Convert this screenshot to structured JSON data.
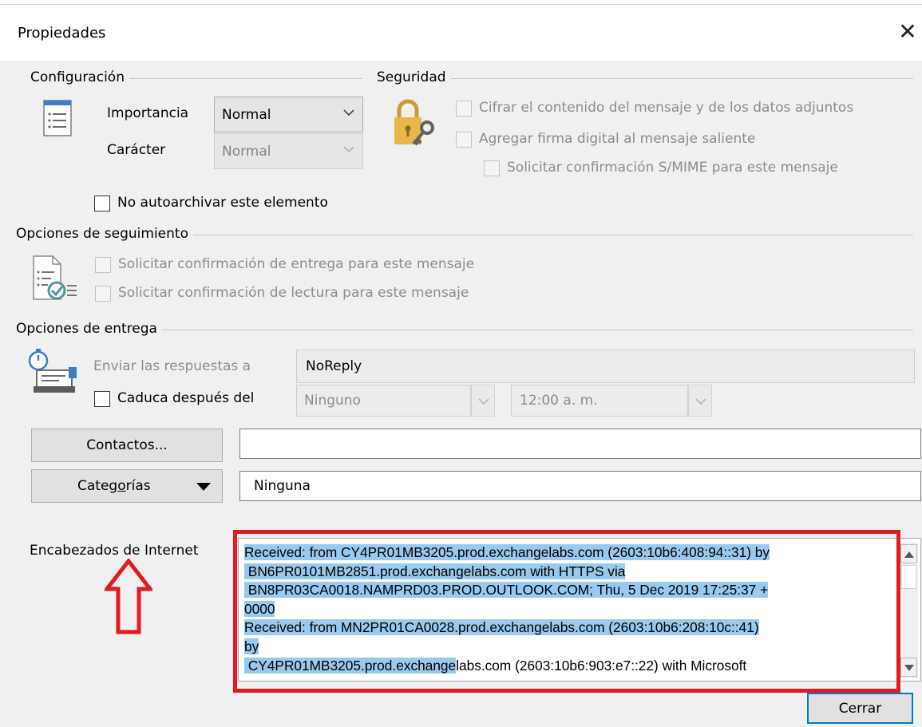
{
  "window": {
    "title": "Propiedades",
    "close_glyph": "✕"
  },
  "config": {
    "label": "Configuración",
    "importance_label": "Importancia",
    "importance_value": "Normal",
    "character_label": "Carácter",
    "character_value": "Normal",
    "no_autoarchive_label": "No autoarchivar este elemento"
  },
  "security": {
    "label": "Seguridad",
    "encrypt_label": "Cifrar el contenido del mensaje y de los datos adjuntos",
    "sign_label": "Agregar firma digital al mensaje saliente",
    "smime_label": "Solicitar confirmación S/MIME para este mensaje"
  },
  "tracking": {
    "label": "Opciones de seguimiento",
    "delivery_receipt_label": "Solicitar confirmación de entrega para este mensaje",
    "read_receipt_label": "Solicitar confirmación de lectura para este mensaje"
  },
  "delivery": {
    "label": "Opciones de entrega",
    "replies_to_label": "Enviar las respuestas a",
    "replies_to_value": "NoReply",
    "expires_label": "Caduca después del",
    "expires_date": "Ninguno",
    "expires_time": "12:00 a. m."
  },
  "contacts": {
    "button_label": "Contactos...",
    "value": ""
  },
  "categories": {
    "button_prefix": "Categ",
    "button_accel": "o",
    "button_suffix": "rías",
    "value": "Ninguna"
  },
  "internet_headers": {
    "label": "Encabezados de Internet",
    "lines": [
      "Received: from CY4PR01MB3205.prod.exchangelabs.com (2603:10b6:408:94::31) by",
      " BN6PR0101MB2851.prod.exchangelabs.com with HTTPS via",
      " BN8PR03CA0018.NAMPRD03.PROD.OUTLOOK.COM; Thu, 5 Dec 2019 17:25:37 +",
      "0000",
      "Received: from MN2PR01CA0028.prod.exchangelabs.com (2603:10b6:208:10c::41)",
      "by",
      " CY4PR01MB3205.prod.exchangelabs.com (2603:10b6:903:e7::22) with Microsoft"
    ],
    "last_line_highlighted": " CY4PR01MB3205.prod.exchange",
    "last_line_rest": "labs.com (2603:10b6:903:e7::22) with Microsoft"
  },
  "footer": {
    "close_button_label": "Cerrar"
  },
  "colors": {
    "highlight": "#99c9ef",
    "annotation_red": "#e21b23",
    "default_button_border": "#0078d7"
  }
}
